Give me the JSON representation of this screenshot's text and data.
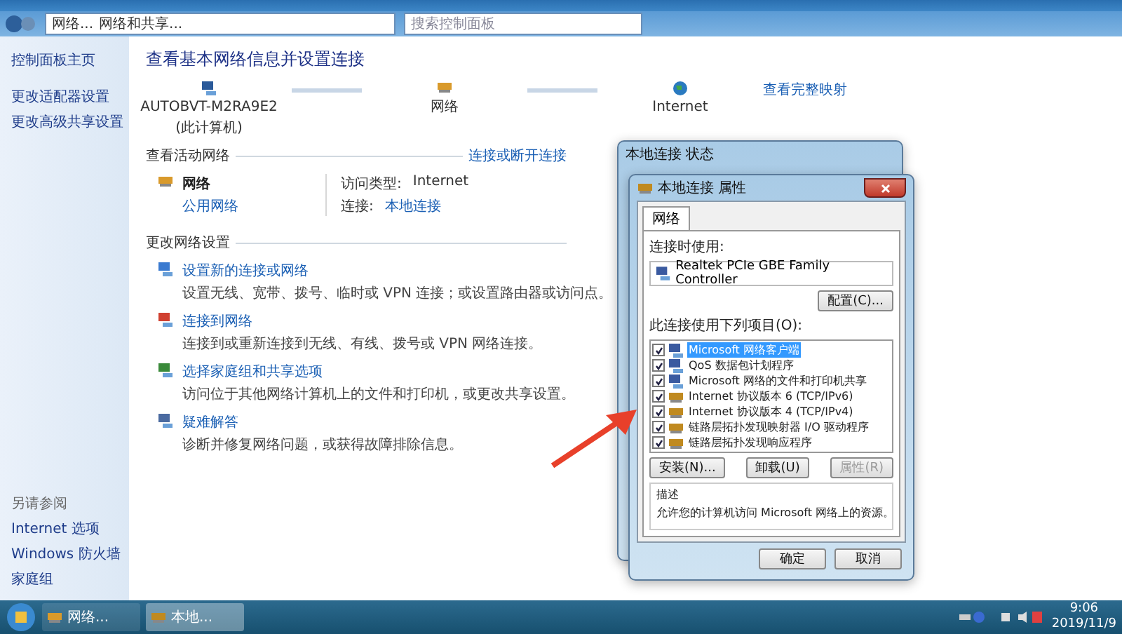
{
  "window": {
    "breadcrumb": [
      "网络...",
      "网络和共享..."
    ],
    "search": {
      "placeholder": "搜索控制面板"
    }
  },
  "sidebar": {
    "links": [
      "控制面板主页",
      "更改适配器设置",
      "更改高级共享设置"
    ],
    "see_also": {
      "title": "另请参阅",
      "links": [
        "Internet 选项",
        "Windows 防火墙",
        "家庭组"
      ]
    }
  },
  "main": {
    "title": "查看基本网络信息并设置连接",
    "map": {
      "nodes": [
        {
          "kind": "computer",
          "label": "AUTOBVT-M2RA9E2",
          "sublabel": "(此计算机)"
        },
        {
          "kind": "network",
          "label": "网络"
        },
        {
          "kind": "internet",
          "label": "Internet"
        }
      ],
      "full_map_link": "查看完整映射"
    },
    "active_networks": {
      "heading": "查看活动网络",
      "link": "连接或断开连接",
      "network": {
        "name": "网络",
        "type": "公用网络"
      },
      "details": [
        {
          "label": "访问类型:",
          "value": "Internet",
          "kind": "text"
        },
        {
          "label": "连接:",
          "value": "本地连接",
          "kind": "link"
        }
      ]
    },
    "change_settings": {
      "heading": "更改网络设置",
      "items": [
        {
          "kind": "setup",
          "title": "设置新的连接或网络",
          "description": "设置无线、宽带、拨号、临时或 VPN 连接；或设置路由器或访问点。"
        },
        {
          "kind": "connect",
          "title": "连接到网络",
          "description": "连接到或重新连接到无线、有线、拨号或 VPN 网络连接。"
        },
        {
          "kind": "homegroup",
          "title": "选择家庭组和共享选项",
          "description": "访问位于其他网络计算机上的文件和打印机，或更改共享设置。"
        },
        {
          "kind": "troubleshoot",
          "title": "疑难解答",
          "description": "诊断并修复网络问题，或获得故障排除信息。"
        }
      ]
    }
  },
  "status_dialog": {
    "title": "本地连接 状态"
  },
  "dialog": {
    "title": "本地连接 属性",
    "tabs": [
      {
        "label": "网络",
        "selected": true
      }
    ],
    "connect_using_label": "连接时使用:",
    "adapter": "Realtek PCIe GBE Family Controller",
    "configure_button": "配置(C)...",
    "items_label": "此连接使用下列项目(O):",
    "items": [
      {
        "label": "Microsoft 网络客户端",
        "checked": true,
        "selected": true,
        "kind": "client"
      },
      {
        "label": "QoS 数据包计划程序",
        "checked": true,
        "selected": false,
        "kind": "service"
      },
      {
        "label": "Microsoft 网络的文件和打印机共享",
        "checked": true,
        "selected": false,
        "kind": "service"
      },
      {
        "label": "Internet 协议版本 6 (TCP/IPv6)",
        "checked": true,
        "selected": false,
        "kind": "protocol"
      },
      {
        "label": "Internet 协议版本 4 (TCP/IPv4)",
        "checked": true,
        "selected": false,
        "kind": "protocol"
      },
      {
        "label": "链路层拓扑发现映射器 I/O 驱动程序",
        "checked": true,
        "selected": false,
        "kind": "protocol"
      },
      {
        "label": "链路层拓扑发现响应程序",
        "checked": true,
        "selected": false,
        "kind": "protocol"
      }
    ],
    "buttons": [
      {
        "label": "安装(N)...",
        "disabled": false
      },
      {
        "label": "卸载(U)",
        "disabled": false
      },
      {
        "label": "属性(R)",
        "disabled": true
      }
    ],
    "description": {
      "title": "描述",
      "text": "允许您的计算机访问 Microsoft 网络上的资源。"
    },
    "footer_buttons": [
      "确定",
      "取消"
    ]
  },
  "taskbar": {
    "items": [
      {
        "label": "网络...",
        "kind": "network",
        "selected": false
      },
      {
        "label": "本地...",
        "kind": "connection",
        "selected": true
      }
    ],
    "clock": {
      "time": "9:06",
      "date": "2019/11/9"
    }
  }
}
